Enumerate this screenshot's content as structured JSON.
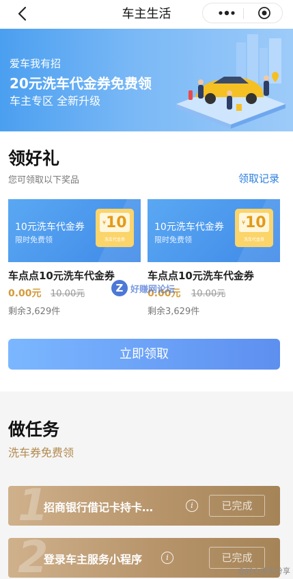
{
  "header": {
    "title": "车主生活"
  },
  "banner": {
    "line1": "爱车我有招",
    "line2": "20元洗车代金券免费领",
    "line3": "车主专区 全新升级"
  },
  "gifts": {
    "heading": "领好礼",
    "subheading": "您可领取以下奖品",
    "record_link": "领取记录",
    "items": [
      {
        "card_title": "10元洗车代金券",
        "card_sub": "限时免费领",
        "coupon_symbol": "¥",
        "coupon_value": "10",
        "coupon_caption": "洗车代金券",
        "name": "车点点10元洗车代金券",
        "price": "0.00元",
        "original_price": "10.00元",
        "remaining": "剩余3,629件"
      },
      {
        "card_title": "10元洗车代金券",
        "card_sub": "限时免费领",
        "coupon_symbol": "¥",
        "coupon_value": "10",
        "coupon_caption": "洗车代金券",
        "name": "车点点10元洗车代金券",
        "price": "0.00元",
        "original_price": "10.00元",
        "remaining": "剩余3,629件"
      }
    ],
    "claim_button": "立即领取"
  },
  "tasks": {
    "heading": "做任务",
    "subheading": "洗车券免费领",
    "items": [
      {
        "num": "1",
        "title": "招商银行借记卡持卡…",
        "status": "已完成"
      },
      {
        "num": "2",
        "title": "登录车主服务小程序",
        "status": "已完成"
      }
    ]
  },
  "watermarks": {
    "center_badge": "Z",
    "center_text": "好赚网论坛",
    "bottom_right": "@好心天天分享"
  },
  "colors": {
    "accent_blue": "#2e7fe0",
    "banner_blue": "#4b9ff0",
    "gold": "#b28a4f",
    "price_gold": "#d39a38"
  }
}
